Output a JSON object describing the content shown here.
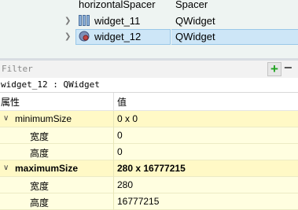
{
  "object_tree": {
    "rows": [
      {
        "name": "horizontalSpacer",
        "class": "Spacer"
      },
      {
        "name": "widget_11",
        "class": "QWidget"
      },
      {
        "name": "widget_12",
        "class": "QWidget"
      }
    ]
  },
  "filter": {
    "placeholder": "Filter",
    "add_label": "+",
    "remove_label": "−"
  },
  "object_info": "widget_12 : QWidget",
  "property_editor": {
    "header": {
      "property": "属性",
      "value": "值"
    },
    "rows": [
      {
        "name": "minimumSize",
        "value": "0 x 0"
      },
      {
        "name": "宽度",
        "value": "0"
      },
      {
        "name": "高度",
        "value": "0"
      },
      {
        "name": "maximumSize",
        "value": "280 x 16777215"
      },
      {
        "name": "宽度",
        "value": "280"
      },
      {
        "name": "高度",
        "value": "16777215"
      }
    ]
  },
  "colors": {
    "selection": "#cde6f7",
    "property_row": "#fffee0",
    "property_row_alt": "#fff9c6",
    "add_icon": "#21a321"
  },
  "icons": {
    "expand": "chevron-right-icon",
    "collapse": "chevron-down-icon",
    "layout": "horizontal-layout-icon",
    "widget": "widget-icon"
  }
}
